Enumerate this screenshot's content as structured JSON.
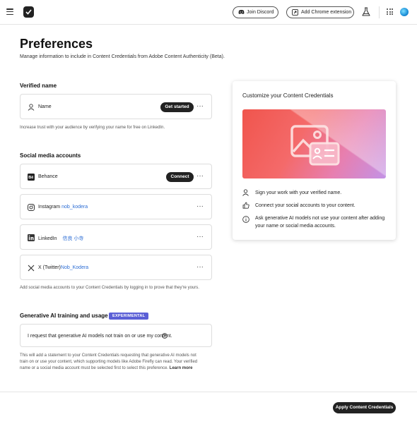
{
  "topbar": {
    "discord_label": "Join Discord",
    "chrome_label": "Add Chrome extension"
  },
  "page": {
    "title": "Preferences",
    "subtitle": "Manage information to include in Content Credentials from Adobe Content Authenticity (Beta)."
  },
  "verified": {
    "heading": "Verified name",
    "row_label": "Name",
    "button": "Get started",
    "note": "Increase trust with your audience by verifying your name for free on LinkedIn."
  },
  "social": {
    "heading": "Social media accounts",
    "accounts": [
      {
        "platform": "Behance",
        "handle": "",
        "button": "Connect"
      },
      {
        "platform": "Instagram",
        "handle": "nob_kodera"
      },
      {
        "platform": "LinkedIn",
        "handle": "信良 小寺"
      },
      {
        "platform": "X (Twitter)",
        "handle": "Nob_Kodera"
      }
    ],
    "note": "Add social media accounts to your Content Credentials by logging in to prove that they're yours."
  },
  "genai": {
    "heading": "Generative AI training and usage",
    "badge": "EXPERIMENTAL",
    "row_label": "I request that generative AI models not train on or use my content.",
    "note_line1": "This will add a statement to your Content Credentials requesting that generative AI models not",
    "note_line2": "train on or use your content, which supporting models like Adobe Firefly can read. Your verified",
    "note_line3": "name or a social media account must be selected first to select this preference.",
    "learn_more": "Learn more"
  },
  "side": {
    "title": "Customize your Content Credentials",
    "features": [
      {
        "icon": "person-icon",
        "text": "Sign your work with your verified name."
      },
      {
        "icon": "thumbs-up-icon",
        "text": "Connect your social accounts to your content."
      },
      {
        "icon": "info-icon",
        "text": "Ask generative AI models not use your content after adding your name or social media accounts."
      }
    ]
  },
  "footer": {
    "apply_label": "Apply Content Credentials"
  },
  "colors": {
    "accent_link": "#2b6cd4",
    "badge": "#5b5fd6",
    "button_dark": "#222222"
  }
}
